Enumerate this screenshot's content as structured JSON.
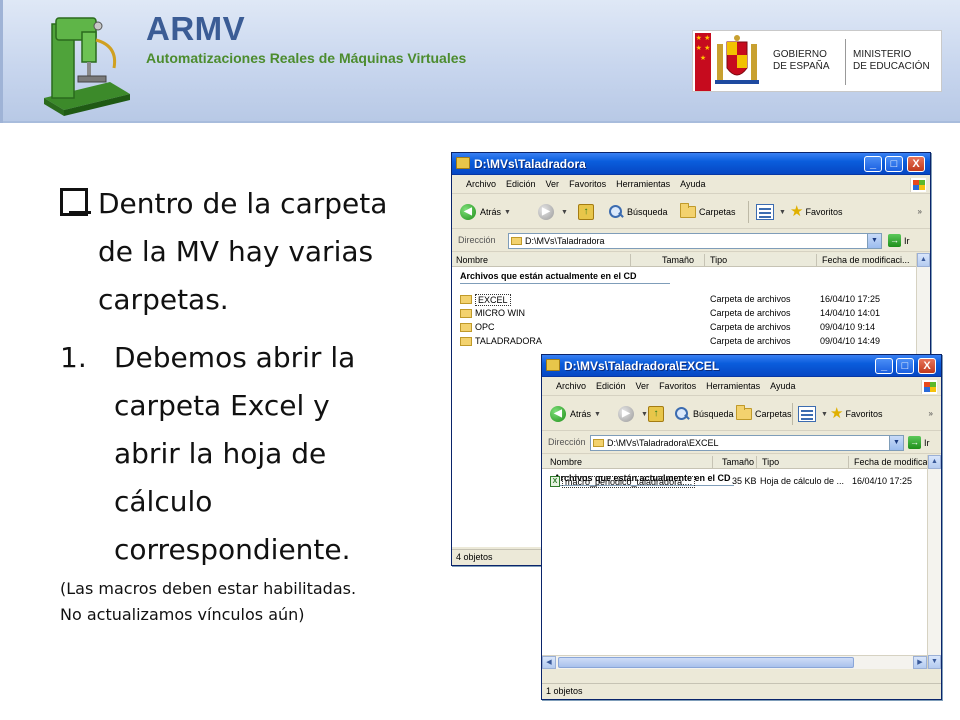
{
  "header": {
    "app_title": "ARMV",
    "app_subtitle": "Automatizaciones Reales de Máquinas Virtuales",
    "gov_line1": "GOBIERNO",
    "gov_line2": "DE ESPAÑA",
    "ministry_line1": "MINISTERIO",
    "ministry_line2": "DE EDUCACIÓN"
  },
  "slide": {
    "bullet_lines": [
      "Dentro de la carpeta",
      "de la MV hay varias",
      "carpetas."
    ],
    "numbered_marker": "1.",
    "numbered_lines": [
      "Debemos abrir la",
      "carpeta Excel y",
      "abrir la hoja de",
      "cálculo",
      "correspondiente."
    ],
    "note_lines": [
      "(Las macros deben estar habilitadas.",
      "No actualizamos vínculos aún)"
    ]
  },
  "explorer_common": {
    "menu": [
      "Archivo",
      "Edición",
      "Ver",
      "Favoritos",
      "Herramientas",
      "Ayuda"
    ],
    "back_label": "Atrás",
    "search_label": "Búsqueda",
    "folders_label": "Carpetas",
    "favorites_label": "Favoritos",
    "address_label": "Dirección",
    "go_label": "Ir",
    "columns": [
      "Nombre",
      "Tamaño",
      "Tipo",
      "Fecha de modificaci..."
    ],
    "group_label": "Archivos que están actualmente en el CD"
  },
  "window1": {
    "title": "D:\\MVs\\Taladradora",
    "address": "D:\\MVs\\Taladradora",
    "rows": [
      {
        "name": "EXCEL",
        "size": "",
        "type": "Carpeta de archivos",
        "date": "16/04/10 17:25"
      },
      {
        "name": "MICRO WIN",
        "size": "",
        "type": "Carpeta de archivos",
        "date": "14/04/10 14:01"
      },
      {
        "name": "OPC",
        "size": "",
        "type": "Carpeta de archivos",
        "date": "09/04/10 9:14"
      },
      {
        "name": "TALADRADORA",
        "size": "",
        "type": "Carpeta de archivos",
        "date": "09/04/10 14:49"
      }
    ],
    "status": "4 objetos"
  },
  "window2": {
    "title": "D:\\MVs\\Taladradora\\EXCEL",
    "address": "D:\\MVs\\Taladradora\\EXCEL",
    "rows": [
      {
        "name": "macro_periodico_taladradora....",
        "size": "35 KB",
        "type": "Hoja de cálculo de ...",
        "date": "16/04/10 17:25"
      }
    ],
    "status": "1 objetos"
  },
  "icons": {
    "window_minimize": "_",
    "window_maximize": "□",
    "window_close": "X",
    "flag_stars": "★ ★ ★ ★ ★"
  },
  "colors": {
    "title_bar": "#0a5ddc",
    "banner": "#c8d6ee",
    "subtitle_green": "#4c8c2e",
    "title_blue": "#3b5c95"
  }
}
